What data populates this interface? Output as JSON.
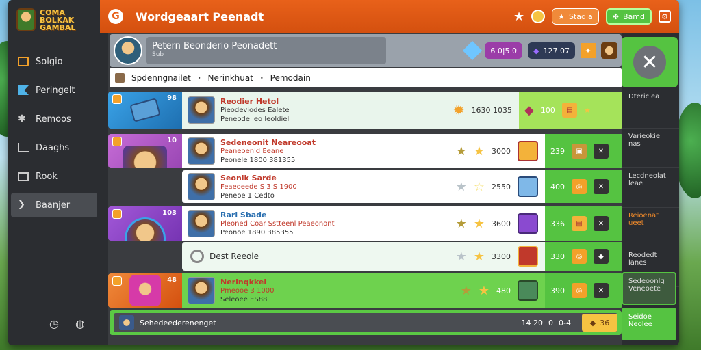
{
  "app": {
    "logo_line1": "COMA",
    "logo_line2": "BOLKAK",
    "logo_line3": "GAMBAL",
    "title": "Wordgeaart Peenadt"
  },
  "topbar": {
    "g_icon": "G",
    "star_icon": "★",
    "coin_icon": "●",
    "pill1_label": "Stadia",
    "pill2_label": "Bamd",
    "settings_icon": "⚙"
  },
  "sidebar": {
    "items": [
      {
        "label": "Solgio",
        "icon": "box-icon",
        "active": false
      },
      {
        "label": "Peringelt",
        "icon": "flag-icon",
        "active": false
      },
      {
        "label": "Remoos",
        "icon": "gear-icon",
        "active": false
      },
      {
        "label": "Daaghs",
        "icon": "chart-icon",
        "active": false
      },
      {
        "label": "Rook",
        "icon": "home-icon",
        "active": false
      },
      {
        "label": "Baanjer",
        "icon": "arrow-icon",
        "active": true
      }
    ],
    "bottom_left_icon": "◷",
    "bottom_right_icon": "◍"
  },
  "profile": {
    "name": "Petern Beonderio Peonadett",
    "sub": "Sub",
    "gem_value": "6  0|5  0",
    "crystal_value": "127  07"
  },
  "breadcrumbs": [
    "Spdenngnailet",
    "Nerinkhuat",
    "Pemodain"
  ],
  "rows": [
    {
      "num": "98",
      "title": "Reodier Hetol",
      "line2": "Pieodeviodes Ealete",
      "line3": "Peneode ieo leoldiel",
      "stats_left": "1630  1035",
      "value": "100"
    },
    {
      "num": "10",
      "title": "Sedeneonit Neareooat",
      "line2": "Peaneoen'd Eeane",
      "line3": "Peonele  1800  381355",
      "value_a": "3000",
      "value_b": "239"
    },
    {
      "num": "",
      "title": "Seonik Sarde",
      "line2": "Feaeoeede  S 3 S 1900",
      "line3": "Peneoe 1 Cedto",
      "value_a": "2550",
      "value_b": "400"
    },
    {
      "num": "103",
      "title": "Rarl Sbade",
      "line2": "Pleoned Coar Sstteenl  Peaeonont",
      "line3": "Peonoe 1890  385355",
      "value_a": "3600",
      "value_b": "336"
    },
    {
      "num": "",
      "title": "Dest Reeole",
      "value_a": "3300",
      "value_b": "330"
    },
    {
      "num": "48",
      "title": "Nerinqkkel",
      "line2": "Pmeooe  3 1000",
      "line3": "Seleoee ES88",
      "value_a": "480",
      "value_b": "390"
    }
  ],
  "footer": {
    "text": "Sehedeederenenget",
    "stat_a": "14 20",
    "stat_b": "0",
    "stat_c": "0-4",
    "button": "36"
  },
  "right_panel": {
    "items": [
      "Dtericlea",
      "Varieokie nas",
      "Lecdneolat leae",
      "Reioenat ueet",
      "Reodedt lanes"
    ],
    "green_a": "Sedeoonlg Veneoete",
    "green_b": "Seidoe Neolee"
  },
  "colors": {
    "accent": "#e8611a",
    "green": "#55c341",
    "dark": "#2b2d31"
  }
}
